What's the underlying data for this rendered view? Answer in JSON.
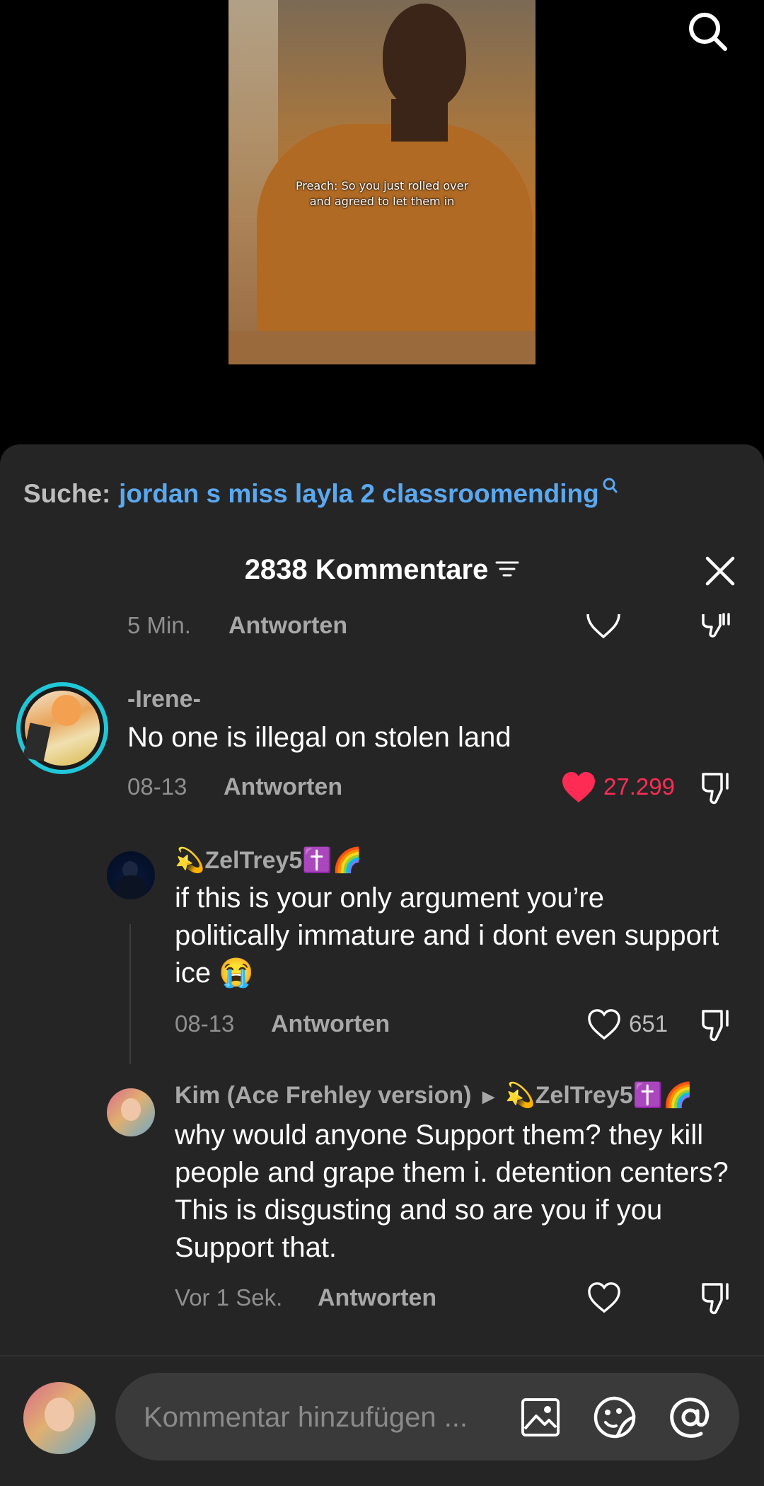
{
  "video": {
    "subtitle_line1": "Preach: So you just rolled over",
    "subtitle_line2": "and agreed to let them in"
  },
  "search_suggestion": {
    "prefix": "Suche:",
    "query": "jordan s miss layla 2 classroomending"
  },
  "comments": {
    "title": "2838 Kommentare",
    "reply_label": "Antworten",
    "partial": {
      "time": "5 Min."
    },
    "items": [
      {
        "username": "-Irene-",
        "text": "No one is illegal on stolen land",
        "time": "08-13",
        "likes": "27.299",
        "liked": true
      },
      {
        "username": "💫ZelTrey5✝️🌈",
        "text": "if this is your only argument you’re politically immature and i dont even support ice 😭",
        "time": "08-13",
        "likes": "651",
        "liked": false
      },
      {
        "username": "Kim (Ace Frehley version)",
        "reply_to": "💫ZelTrey5✝️🌈",
        "text": "why would anyone Support them? they kill people and grape them i. detention centers? This is disgusting and so are you if you Support that.",
        "time": "Vor 1 Sek.",
        "liked": false
      }
    ]
  },
  "composer": {
    "placeholder": "Kommentar hinzufügen ..."
  },
  "colors": {
    "sheet_bg": "#252525",
    "link_blue": "#5aa8f0",
    "like_red": "#fe2c55",
    "muted": "#8f8f8f"
  },
  "icons": [
    "search-icon",
    "filter-icon",
    "close-icon",
    "heart-icon",
    "dislike-icon",
    "image-icon",
    "emoji-icon",
    "mention-icon"
  ]
}
